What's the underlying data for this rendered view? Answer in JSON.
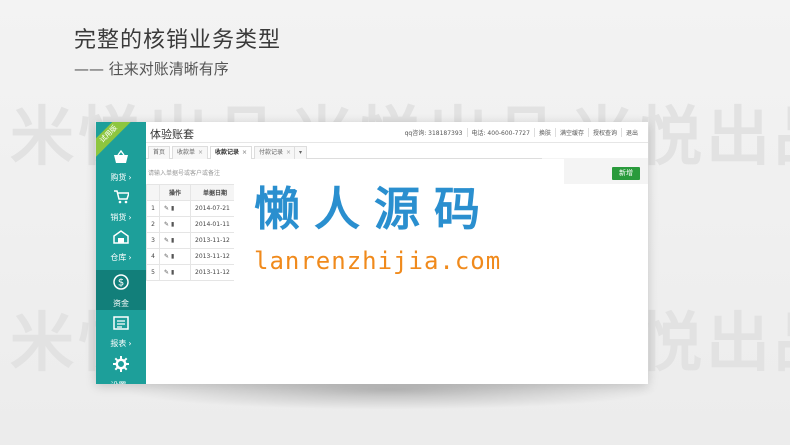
{
  "page": {
    "heading": "完整的核销业务类型",
    "subheading": "—— 往来对账清晰有序",
    "watermark": "米悦出品"
  },
  "app": {
    "title": "体验账套",
    "trial_badge": "试用版",
    "topmenu": [
      "qq咨询: 318187393",
      "电话: 400-600-7727",
      "换肤",
      "满空缓存",
      "授权查询",
      "退出"
    ],
    "tabs": [
      {
        "label": "首页",
        "active": false
      },
      {
        "label": "收款单",
        "active": false
      },
      {
        "label": "收款记录",
        "active": true
      },
      {
        "label": "付款记录",
        "active": false
      }
    ],
    "search_placeholder": "请输入单据号或客户或备注",
    "add_button": "新增"
  },
  "sidebar": {
    "items": [
      {
        "label": "购货",
        "icon": "basket-icon",
        "active": false
      },
      {
        "label": "销货",
        "icon": "cart-icon",
        "active": false
      },
      {
        "label": "仓库",
        "icon": "warehouse-icon",
        "active": false
      },
      {
        "label": "资金",
        "icon": "dollar-icon",
        "active": true
      },
      {
        "label": "报表",
        "icon": "report-icon",
        "active": false
      },
      {
        "label": "设置",
        "icon": "gear-icon",
        "active": false
      }
    ]
  },
  "table": {
    "headers": [
      "",
      "操作",
      "单据日期"
    ],
    "rows": [
      {
        "index": "1",
        "date": "2014-07-21"
      },
      {
        "index": "2",
        "date": "2014-01-11"
      },
      {
        "index": "3",
        "date": "2013-11-12"
      },
      {
        "index": "4",
        "date": "2013-11-12"
      },
      {
        "index": "5",
        "date": "2013-11-12"
      }
    ]
  },
  "overlay": {
    "brand_cn": "懒人源码",
    "brand_url": "lanrenzhijia.com"
  },
  "colors": {
    "sidebar": "#1d9f9a",
    "sidebar_active": "#127f7a",
    "add_button": "#2a9b3c",
    "brand_blue": "#2a8fcf",
    "brand_orange": "#f08a1c"
  }
}
